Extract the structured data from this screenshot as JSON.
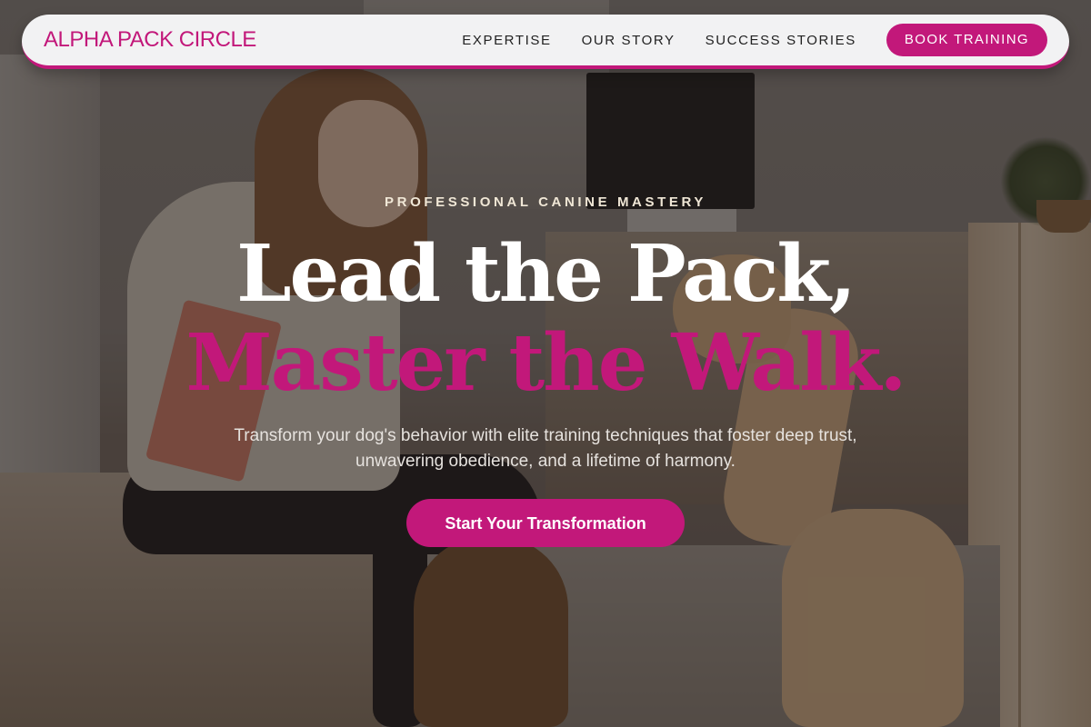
{
  "nav": {
    "brand": "ALPHA PACK CIRCLE",
    "links": [
      "EXPERTISE",
      "OUR STORY",
      "SUCCESS STORIES"
    ],
    "cta": "BOOK TRAINING"
  },
  "hero": {
    "eyebrow": "PROFESSIONAL CANINE MASTERY",
    "headline_line1": "Lead the Pack,",
    "headline_line2": "Master the Walk.",
    "subheadline": "Transform your dog's behavior with elite training techniques that foster deep trust, unwavering obedience, and a lifetime of harmony.",
    "cta": "Start Your Transformation"
  },
  "colors": {
    "accent": "#c2187a",
    "nav_bg": "#f2f2f3",
    "text_light": "#ffffff"
  }
}
